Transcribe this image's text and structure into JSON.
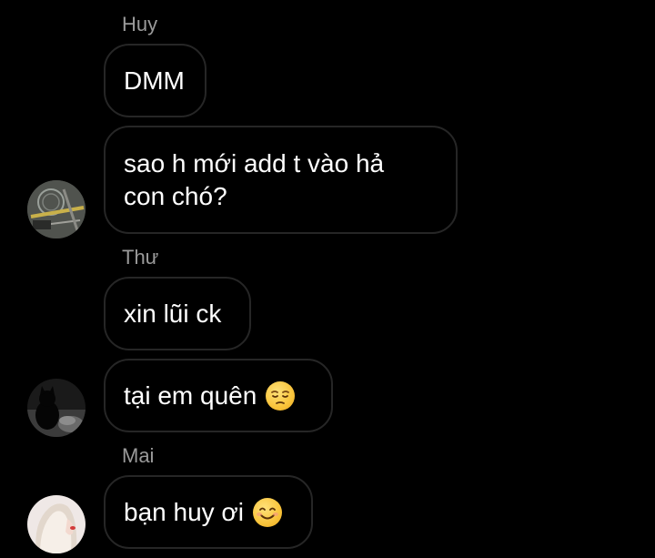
{
  "chat": {
    "messages": [
      {
        "sender": "Huy",
        "bubbles": [
          "DMM",
          "sao h mới add t vào hả\ncon chó?"
        ],
        "avatar_icon": "avatar-huy"
      },
      {
        "sender": "Thư",
        "bubbles": [
          "xin lũi ck",
          "tại em quên"
        ],
        "avatar_icon": "avatar-thu",
        "emoji": "pensive-face-emoji"
      },
      {
        "sender": "Mai",
        "bubbles": [
          "bạn huy ơi"
        ],
        "avatar_icon": "avatar-mai",
        "emoji": "smiling-face-emoji"
      }
    ]
  },
  "colors": {
    "background": "#000000",
    "bubble_border": "#262626",
    "sender_name": "#9a9a9a",
    "text": "#ffffff"
  }
}
